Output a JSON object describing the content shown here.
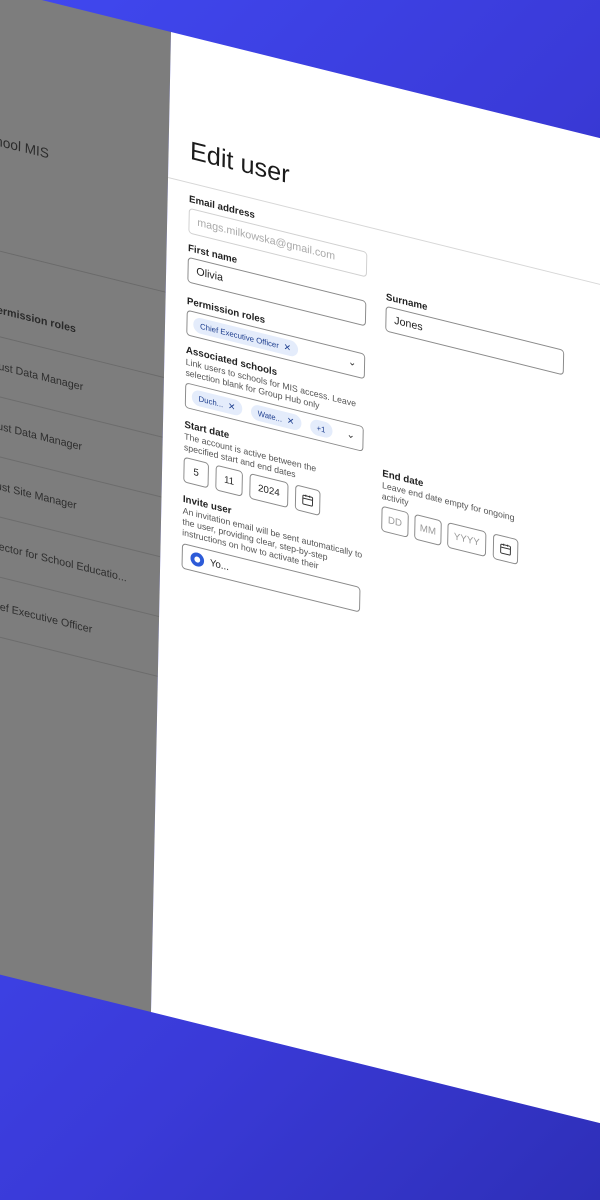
{
  "background": {
    "app_title": "school MIS",
    "table": {
      "header": "Permission roles",
      "rows": [
        "Trust Data Manager",
        "Trust Data Manager",
        "Trust Site Manager",
        "Director for School Educatio...",
        "Chief Executive Officer"
      ]
    }
  },
  "drawer": {
    "title": "Edit user",
    "email": {
      "label": "Email address",
      "value": "mags.milkowska@gmail.com"
    },
    "first_name": {
      "label": "First name",
      "value": "Olivia"
    },
    "surname": {
      "label": "Surname",
      "value": "Jones"
    },
    "permission_roles": {
      "label": "Permission roles",
      "chips": [
        "Chief Executive Officer"
      ]
    },
    "associated_schools": {
      "label": "Associated schools",
      "hint": "Link users to schools for MIS access. Leave selection blank for Group Hub only",
      "chips": [
        "Duch...",
        "Wate..."
      ],
      "more": "+1"
    },
    "start_date": {
      "label": "Start date",
      "hint": "The account is active between the specified start and end dates",
      "day": "5",
      "month": "11",
      "year": "2024"
    },
    "end_date": {
      "label": "End date",
      "hint": "Leave end date empty for ongoing activity",
      "day_ph": "DD",
      "month_ph": "MM",
      "year_ph": "YYYY"
    },
    "invite_user": {
      "label": "Invite user",
      "hint": "An invitation email will be sent automatically to the user, providing clear, step-by-step instructions on how to activate their",
      "option": "Yo..."
    }
  },
  "colors": {
    "accent": "#2d5bd8",
    "chip_bg": "#e4ecfb",
    "backdrop": "#3d43e0"
  }
}
